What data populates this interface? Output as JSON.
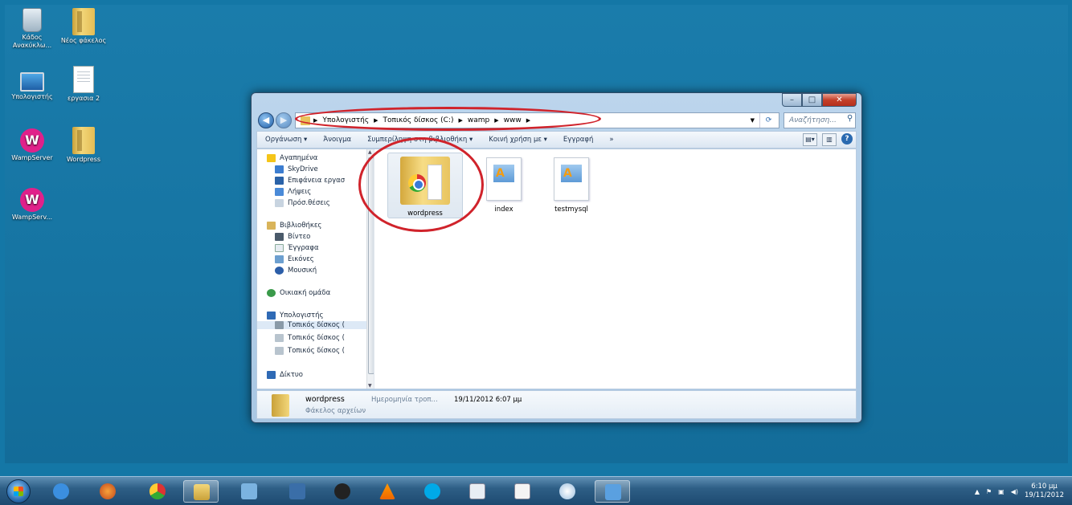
{
  "desktop": {
    "icons": [
      {
        "label": "Κάδος Ανακύκλω..."
      },
      {
        "label": "Νέος φάκελος"
      },
      {
        "label": "Υπολογιστής"
      },
      {
        "label": "εργασια 2"
      },
      {
        "label": "WampServer"
      },
      {
        "label": "Wordpress"
      },
      {
        "label": "WampServ..."
      }
    ]
  },
  "window": {
    "address": {
      "segments": [
        "Υπολογιστής",
        "Τοπικός δίσκος (C:)",
        "wamp",
        "www"
      ]
    },
    "search": {
      "placeholder": "Αναζήτηση..."
    },
    "toolbar": {
      "organize": "Οργάνωση ▾",
      "open": "Άνοιγμα",
      "include": "Συμπερίληψη στη βιβλιοθήκη ▾",
      "share": "Κοινή χρήση με ▾",
      "burn": "Εγγραφή",
      "more": "»"
    },
    "nav": {
      "favorites": "Αγαπημένα",
      "skydrive": "SkyDrive",
      "desktop": "Επιφάνεια εργασ",
      "downloads": "Λήψεις",
      "recent": "Πρόσ.θέσεις",
      "libraries": "Βιβλιοθήκες",
      "videos": "Βίντεο",
      "documents": "Έγγραφα",
      "pictures": "Εικόνες",
      "music": "Μουσική",
      "homegroup": "Οικιακή ομάδα",
      "computer": "Υπολογιστής",
      "disk1": "Τοπικός δίσκος (",
      "disk2": "Τοπικός δίσκος (",
      "disk3": "Τοπικός δίσκος (",
      "network": "Δίκτυο"
    },
    "files": [
      {
        "name": "wordpress"
      },
      {
        "name": "index"
      },
      {
        "name": "testmysql"
      }
    ],
    "details": {
      "name": "wordpress",
      "type": "Φάκελος αρχείων",
      "date_label": "Ημερομηνία τροπ...",
      "date_value": "19/11/2012 6:07 μμ"
    }
  },
  "taskbar": {
    "clock_time": "6:10 μμ",
    "clock_date": "19/11/2012"
  },
  "colors": {
    "desktop": "#1674a2",
    "annotation_red": "#d0232b",
    "taskbar": "#2e5f86"
  }
}
